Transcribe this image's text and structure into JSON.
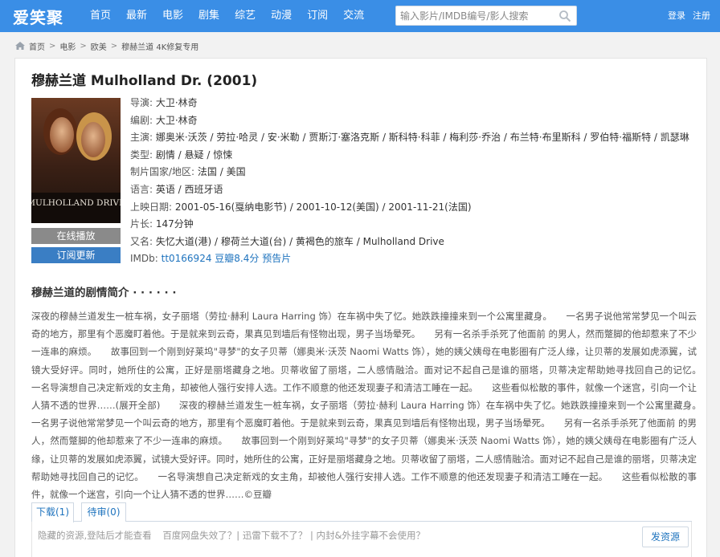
{
  "header": {
    "logo": "爱笑聚",
    "nav": [
      "首页",
      "最新",
      "电影",
      "剧集",
      "综艺",
      "动漫",
      "订阅",
      "交流"
    ],
    "search": {
      "placeholder": "输入影片/IMDB编号/影人搜索",
      "icon": "search-icon"
    },
    "login": "登录",
    "register": "注册",
    "bar_color": "#3a8ee6"
  },
  "breadcrumb": [
    "首页",
    "电影",
    "欧美",
    "穆赫兰道 4K修复专用"
  ],
  "movie": {
    "title": "穆赫兰道 Mulholland Dr. (2001)",
    "poster_text": "MULHOLLAND DRIVE",
    "play_button": "在线播放",
    "subscribe_button": "订阅更新",
    "fields": [
      {
        "k": "导演: ",
        "v": "大卫·林奇"
      },
      {
        "k": "编剧: ",
        "v": "大卫·林奇"
      },
      {
        "k": "主演: ",
        "v": "娜奥米·沃茨 / 劳拉·哈灵 / 安·米勒 / 贾斯汀·塞洛克斯 / 斯科特·科菲 / 梅利莎·乔治 / 布兰特·布里斯科 / 罗伯特·福斯特 / 凯瑟琳"
      },
      {
        "k": "类型: ",
        "v": "剧情 / 悬疑 / 惊悚"
      },
      {
        "k": "制片国家/地区: ",
        "v": "法国 / 美国"
      },
      {
        "k": "语言: ",
        "v": "英语 / 西班牙语"
      },
      {
        "k": "上映日期: ",
        "v": "2001-05-16(戛纳电影节) / 2001-10-12(美国) / 2001-11-21(法国)"
      },
      {
        "k": "片长: ",
        "v": "147分钟"
      },
      {
        "k": "又名: ",
        "v": "失忆大道(港) / 穆荷兰大道(台) / 黄褐色的旅车 / Mulholland Drive"
      }
    ],
    "imdb_label": "IMDb: ",
    "imdb_id": "tt0166924",
    "douban_score": "豆瓣8.4分",
    "trailer": "预告片"
  },
  "synopsis": {
    "title": "穆赫兰道的剧情简介 · · · · · ·",
    "text": "深夜的穆赫兰道发生一桩车祸，女子丽塔（劳拉·赫利 Laura Harring 饰）在车祸中失了忆。她跌跌撞撞来到一个公寓里藏身。　　一名男子说他常常梦见一个叫云奇的地方，那里有个恶魔盯着他。于是就来到云奇，果真见到墙后有怪物出现，男子当场晕死。　　另有一名杀手杀死了他面前 的男人，然而蹩脚的他却惹来了不少一连串的麻烦。　　故事回到一个刚到好莱坞\"寻梦\"的女子贝蒂（娜奥米·沃茨 Naomi Watts 饰），她的姨父姨母在电影圈有广泛人缘，让贝蒂的发展如虎添翼，试镜大受好评。同时，她所住的公寓，正好是丽塔藏身之地。贝蒂收留了丽塔，二人感情融洽。面对记不起自己是谁的丽塔，贝蒂决定帮助她寻找回自己的记忆。　　一名导演想自己决定新戏的女主角，却被他人强行安排人选。工作不顺意的他还发现妻子和清洁工睡在一起。　　这些看似松散的事件，就像一个迷宫，引向一个让人猜不透的世界……(展开全部)　　深夜的穆赫兰道发生一桩车祸，女子丽塔（劳拉·赫利 Laura Harring 饰）在车祸中失了忆。她跌跌撞撞来到一个公寓里藏身。　　一名男子说他常常梦见一个叫云奇的地方，那里有个恶魔盯着他。于是就来到云奇，果真见到墙后有怪物出现，男子当场晕死。　　另有一名杀手杀死了他面前 的男人，然而蹩脚的他却惹来了不少一连串的麻烦。　　故事回到一个刚到好莱坞\"寻梦\"的女子贝蒂（娜奥米·沃茨 Naomi Watts 饰），她的姨父姨母在电影圈有广泛人缘，让贝蒂的发展如虎添翼，试镜大受好评。同时，她所住的公寓，正好是丽塔藏身之地。贝蒂收留了丽塔，二人感情融洽。面对记不起自己是谁的丽塔，贝蒂决定帮助她寻找回自己的记忆。　　一名导演想自己决定新戏的女主角，却被他人强行安排人选。工作不顺意的他还发现妻子和清洁工睡在一起。　　这些看似松散的事件，就像一个迷宫，引向一个让人猜不透的世界……©豆瓣"
  },
  "download": {
    "tab_download": "下载(1)",
    "tab_pending": "待审(0)",
    "hint_login": "隐藏的资源,登陆后才能查看",
    "hint_links": "百度网盘失效了？| 迅雷下载不了？ | 内封&外挂字幕不会使用？",
    "post_button": "发资源"
  }
}
